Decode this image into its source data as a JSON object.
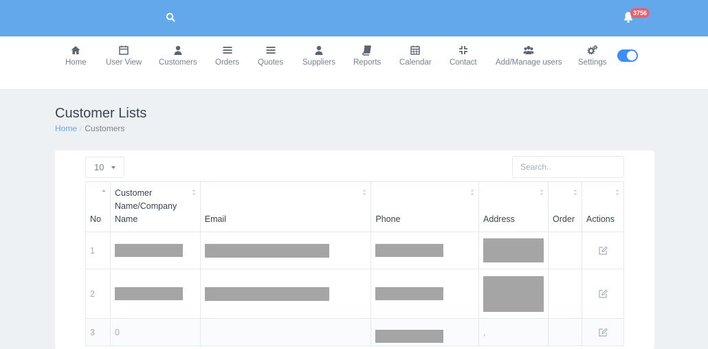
{
  "header": {
    "notification_count": "3756",
    "icons": {
      "search": "search-icon",
      "notifications": "bell-icon"
    }
  },
  "nav": {
    "items": [
      {
        "label": "Home",
        "icon": "home-icon"
      },
      {
        "label": "User View",
        "icon": "calendar-icon"
      },
      {
        "label": "Customers",
        "icon": "user-icon"
      },
      {
        "label": "Orders",
        "icon": "menu-lines-icon"
      },
      {
        "label": "Quotes",
        "icon": "menu-lines-icon"
      },
      {
        "label": "Suppliers",
        "icon": "user-icon"
      },
      {
        "label": "Reports",
        "icon": "book-icon"
      },
      {
        "label": "Contact",
        "icon": "compress-icon"
      },
      {
        "label": "Calendar",
        "icon": "calendar-grid-icon"
      },
      {
        "label": "Add/Manage users",
        "icon": "users-icon"
      },
      {
        "label": "Settings",
        "icon": "gears-icon"
      }
    ],
    "theme_toggle": "on"
  },
  "page": {
    "title": "Customer Lists",
    "breadcrumb": {
      "home": "Home",
      "separator": "/",
      "current": "Customers"
    }
  },
  "table_controls": {
    "page_length": "10",
    "search_placeholder": "Search.."
  },
  "table": {
    "columns": [
      "No",
      "Customer Name/Company Name",
      "Email",
      "Phone",
      "Address",
      "Order",
      "Actions"
    ],
    "col_customer_line1": "Customer",
    "col_customer_line2": "Name/Company",
    "col_customer_line3": "Name",
    "rows": [
      {
        "no": "1",
        "name": "",
        "email": "",
        "phone": "",
        "address": "",
        "order": ""
      },
      {
        "no": "2",
        "name": "",
        "email": "",
        "phone": "",
        "address": "",
        "order": ""
      },
      {
        "no": "3",
        "name": "0",
        "email": "",
        "phone": "",
        "address": ",",
        "order": ""
      }
    ]
  },
  "colors": {
    "header_bg": "#62a8ea",
    "badge_bg": "#f05e6a",
    "toggle_on": "#3e8ef7",
    "redaction": "#a5a5a5"
  }
}
